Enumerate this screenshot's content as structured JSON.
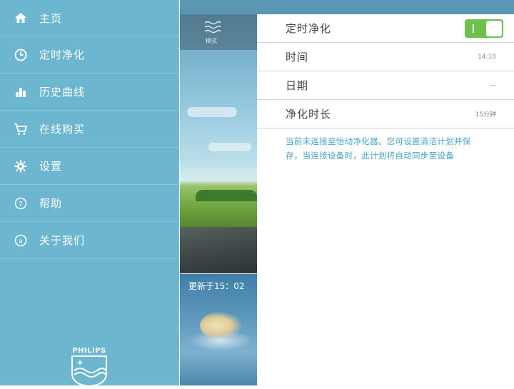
{
  "sidebar": {
    "items": [
      {
        "label": "主页",
        "icon": "home-icon"
      },
      {
        "label": "定时净化",
        "icon": "clock-icon"
      },
      {
        "label": "历史曲线",
        "icon": "bar-chart-icon"
      },
      {
        "label": "在线购买",
        "icon": "cart-icon"
      },
      {
        "label": "设置",
        "icon": "gear-icon"
      },
      {
        "label": "帮助",
        "icon": "help-icon"
      },
      {
        "label": "关于我们",
        "icon": "about-icon"
      }
    ],
    "logo_text": "PHILIPS"
  },
  "photo": {
    "mode_label": "模式",
    "updated_label": "更新于15：02"
  },
  "settings": {
    "rows": [
      {
        "label": "定时净化",
        "value": ""
      },
      {
        "label": "时间",
        "value": "14:10"
      },
      {
        "label": "日期",
        "value": "—"
      },
      {
        "label": "净化时长",
        "value": "15分钟"
      }
    ],
    "toggle_on": true,
    "info": "当前未连接至怡动净化器。您可设置清洁计划并保存，当连接设备时，此计划将自动同步至设备"
  },
  "colors": {
    "sidebar": "#6cb6cf",
    "accent_text": "#4da3cf",
    "toggle": "#6fbf4a"
  }
}
